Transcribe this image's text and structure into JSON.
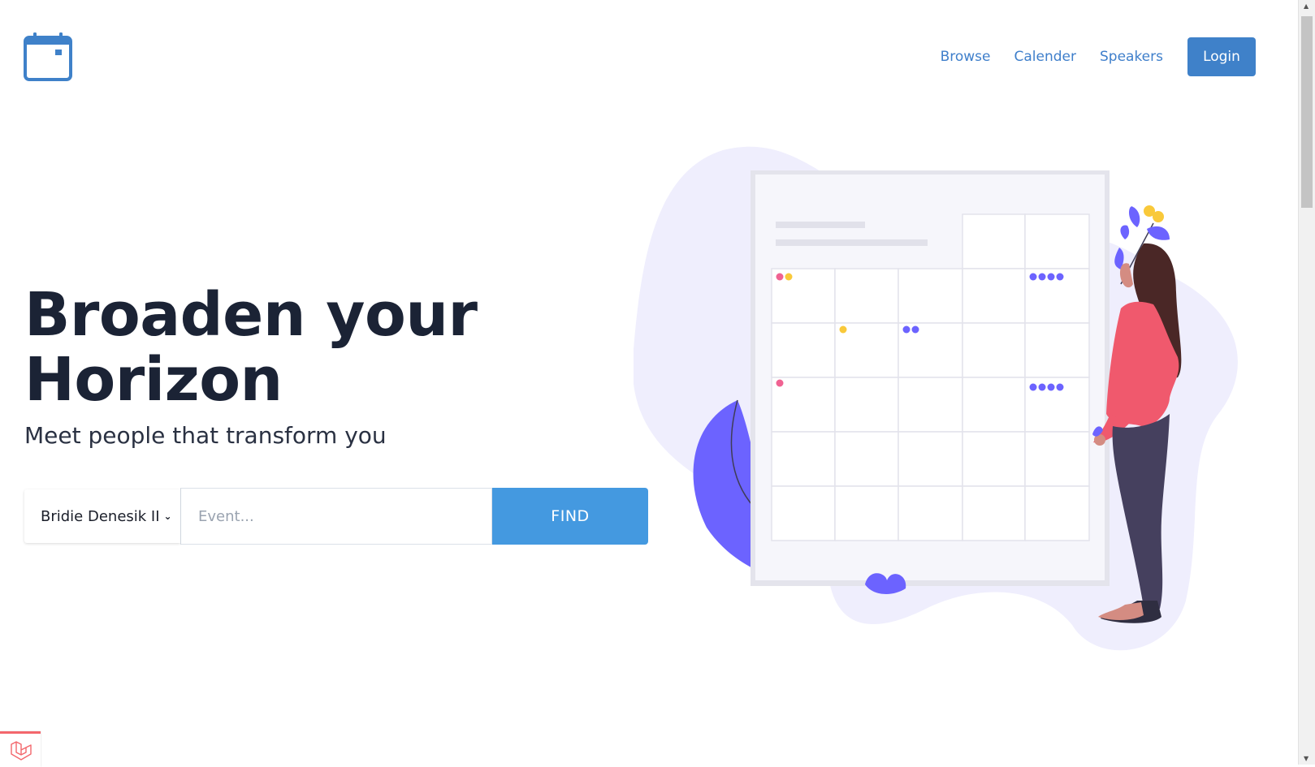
{
  "header": {
    "logo_icon": "calendar-icon",
    "nav": [
      {
        "label": "Browse"
      },
      {
        "label": "Calender"
      },
      {
        "label": "Speakers"
      }
    ],
    "login_label": "Login"
  },
  "hero": {
    "title_line1": "Broaden your",
    "title_line2": "Horizon",
    "subtitle": "Meet people that transform you"
  },
  "search": {
    "selected_option": "Bridie Denesik II",
    "event_placeholder": "Event...",
    "event_value": "",
    "find_label": "FIND"
  },
  "colors": {
    "accent": "#4499e0",
    "nav_link": "#3f7fcb",
    "login_bg": "#3f81c9",
    "illustration_purple": "#6c63ff",
    "illustration_pink": "#f06292",
    "illustration_yellow": "#f9c93a"
  },
  "debug_badge_icon": "laravel-icon"
}
